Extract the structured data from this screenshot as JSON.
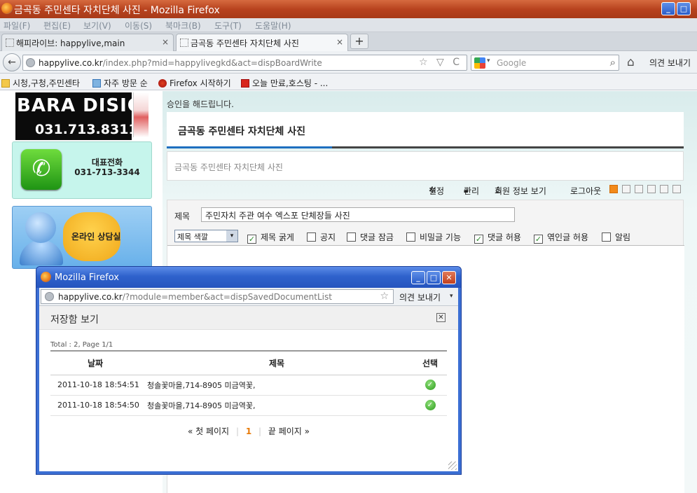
{
  "window": {
    "title": "금곡동 주민센타 자치단체 사진 - Mozilla Firefox",
    "controls": {
      "minimize": "_",
      "maximize": "□",
      "close": "✕"
    }
  },
  "menubar": {
    "items": [
      "파일(F)",
      "편집(E)",
      "보기(V)",
      "이동(S)",
      "북마크(B)",
      "도구(T)",
      "도움말(H)"
    ]
  },
  "tabs": [
    {
      "label": "해피라이브: happylive,main",
      "close": "×"
    },
    {
      "label": "금곡동 주민센타 자치단체 사진",
      "close": "×"
    }
  ],
  "newtab_label": "+",
  "navbar": {
    "back": "←",
    "url_domain": "happylive.co.kr",
    "url_path": "/index.php?mid=happylivegkd&act=dispBoardWrite",
    "url_icons": "☆ ▽ C",
    "search_placeholder": "Google",
    "search_dropdown": "▾",
    "search_icon": "⌕",
    "home_icon": "⌂",
    "feedback": "의견 보내기"
  },
  "bookmarks": [
    "시청,구청,주민센타",
    "자주 방문 순",
    "Firefox 시작하기",
    "오늘 만료,호스팅 - ..."
  ],
  "sidebar": {
    "logo_line1": "BARA DISIGN",
    "logo_line2": "031.713.8311",
    "phone_label": "대표전화",
    "phone_number": "031-713-3344",
    "phone_icon": "✆",
    "consult_label": "온라인 상담실"
  },
  "board": {
    "top_note": "승인을 해드립니다.",
    "heading": "금곡동 주민센타 자치단체 사진",
    "description": "금곡동 주민센타 자치단체 사진",
    "tools": {
      "settings": "설정",
      "manage": "관리",
      "member_info": "회원 정보 보기",
      "logout": "로그아웃"
    }
  },
  "form": {
    "title_label": "제목",
    "title_value": "주민자치 주관 여수 엑스포 단체장들 사진",
    "color_select": "제목 색깔",
    "select_arrow": "▾",
    "check_mark": "✓",
    "options": [
      {
        "label": "제목 굵게",
        "checked": true
      },
      {
        "label": "공지",
        "checked": false
      },
      {
        "label": "댓글 잠금",
        "checked": false
      },
      {
        "label": "비밀글 기능",
        "checked": false
      },
      {
        "label": "댓글 허용",
        "checked": true
      },
      {
        "label": "엮인글 허용",
        "checked": true
      },
      {
        "label": "알림",
        "checked": false
      }
    ]
  },
  "popup": {
    "title": "Mozilla Firefox",
    "url_domain": "happylive.co.kr",
    "url_path": "/?module=member&act=dispSavedDocumentList",
    "feedback": "의견 보내기",
    "feedback_arrow": "▾",
    "star": "☆",
    "heading": "저장함 보기",
    "close_x": "✕",
    "total": "Total : 2, Page 1/1",
    "columns": [
      "날짜",
      "제목",
      "선택"
    ],
    "rows": [
      {
        "date": "2011-10-18 18:54:51",
        "title": "청솔꽃마을,714-8905 미금역꽃,",
        "select": "✓"
      },
      {
        "date": "2011-10-18 18:54:50",
        "title": "청솔꽃마을,714-8905 미금역꽃,",
        "select": "✓"
      }
    ],
    "pager": {
      "first": "« 첫 페이지",
      "current": "1",
      "last": "끝 페이지 »"
    }
  }
}
